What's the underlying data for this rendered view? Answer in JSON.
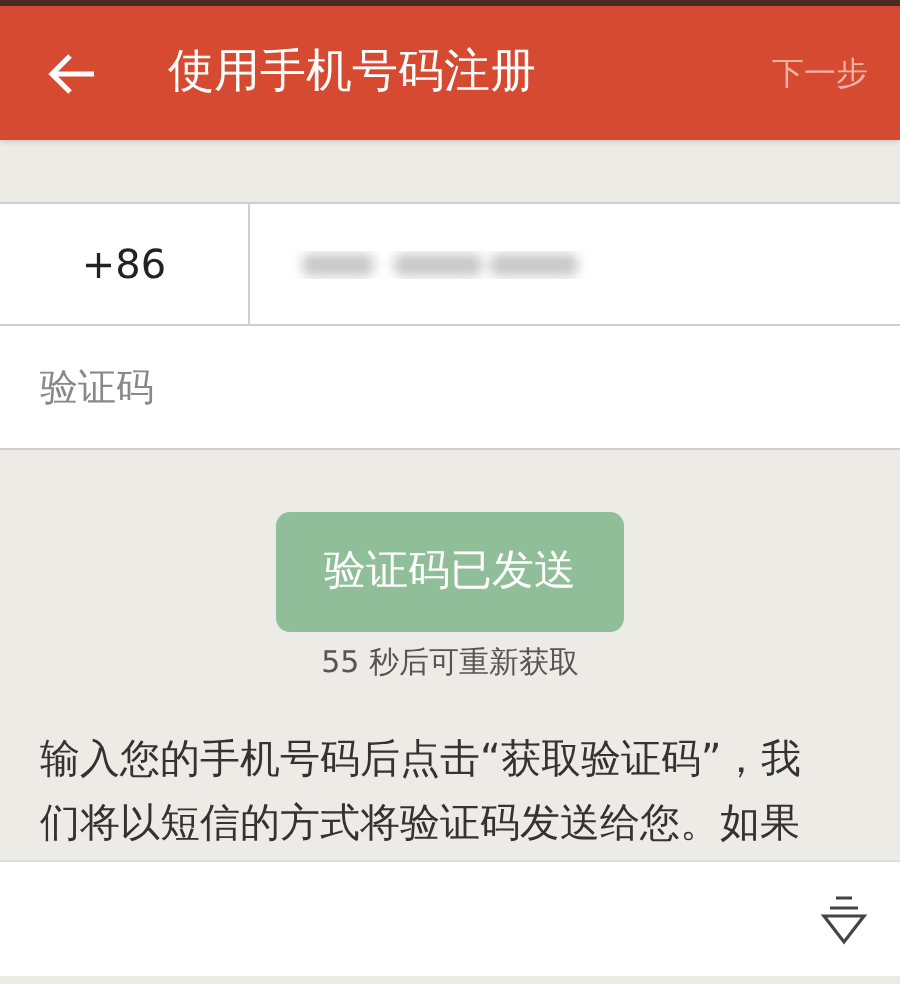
{
  "header": {
    "title": "使用手机号码注册",
    "next": "下一步"
  },
  "form": {
    "country_code": "+86",
    "phone": {
      "kind": "blurred"
    },
    "code_field": {
      "placeholder": "验证码"
    }
  },
  "send_button": {
    "label": "验证码已发送",
    "disabled": true
  },
  "countdown": "55 秒后可重新获取",
  "instructions": [
    "输入您的手机号码后点击“获取验证码”，我",
    "们将以短信的方式将验证码发送给您。如果"
  ]
}
